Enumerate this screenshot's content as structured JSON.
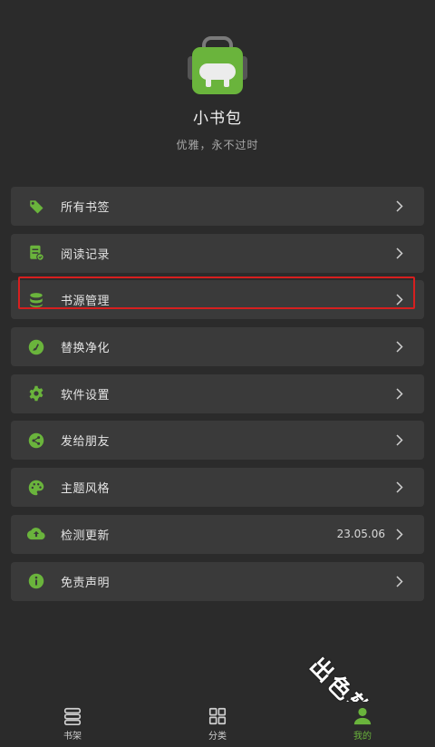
{
  "app": {
    "name": "小书包",
    "tagline": "优雅，永不过时"
  },
  "colors": {
    "accent": "#6ab43c",
    "background": "#2b2b2b",
    "card": "#3a3a3a",
    "highlight": "#d61f1f"
  },
  "menu": [
    {
      "icon": "tag-icon",
      "label": "所有书签",
      "value": ""
    },
    {
      "icon": "reading-record-icon",
      "label": "阅读记录",
      "value": ""
    },
    {
      "icon": "database-icon",
      "label": "书源管理",
      "value": "",
      "highlighted": true
    },
    {
      "icon": "brush-icon",
      "label": "替换净化",
      "value": ""
    },
    {
      "icon": "gear-icon",
      "label": "软件设置",
      "value": ""
    },
    {
      "icon": "share-icon",
      "label": "发给朋友",
      "value": ""
    },
    {
      "icon": "palette-icon",
      "label": "主题风格",
      "value": ""
    },
    {
      "icon": "cloud-upload-icon",
      "label": "检测更新",
      "value": "23.05.06"
    },
    {
      "icon": "info-icon",
      "label": "免责声明",
      "value": ""
    }
  ],
  "bottom_nav": [
    {
      "icon": "bookshelf-icon",
      "label": "书架",
      "active": false
    },
    {
      "icon": "grid-icon",
      "label": "分类",
      "active": false
    },
    {
      "icon": "person-icon",
      "label": "我的",
      "active": true
    }
  ],
  "watermark": "出色软件站"
}
